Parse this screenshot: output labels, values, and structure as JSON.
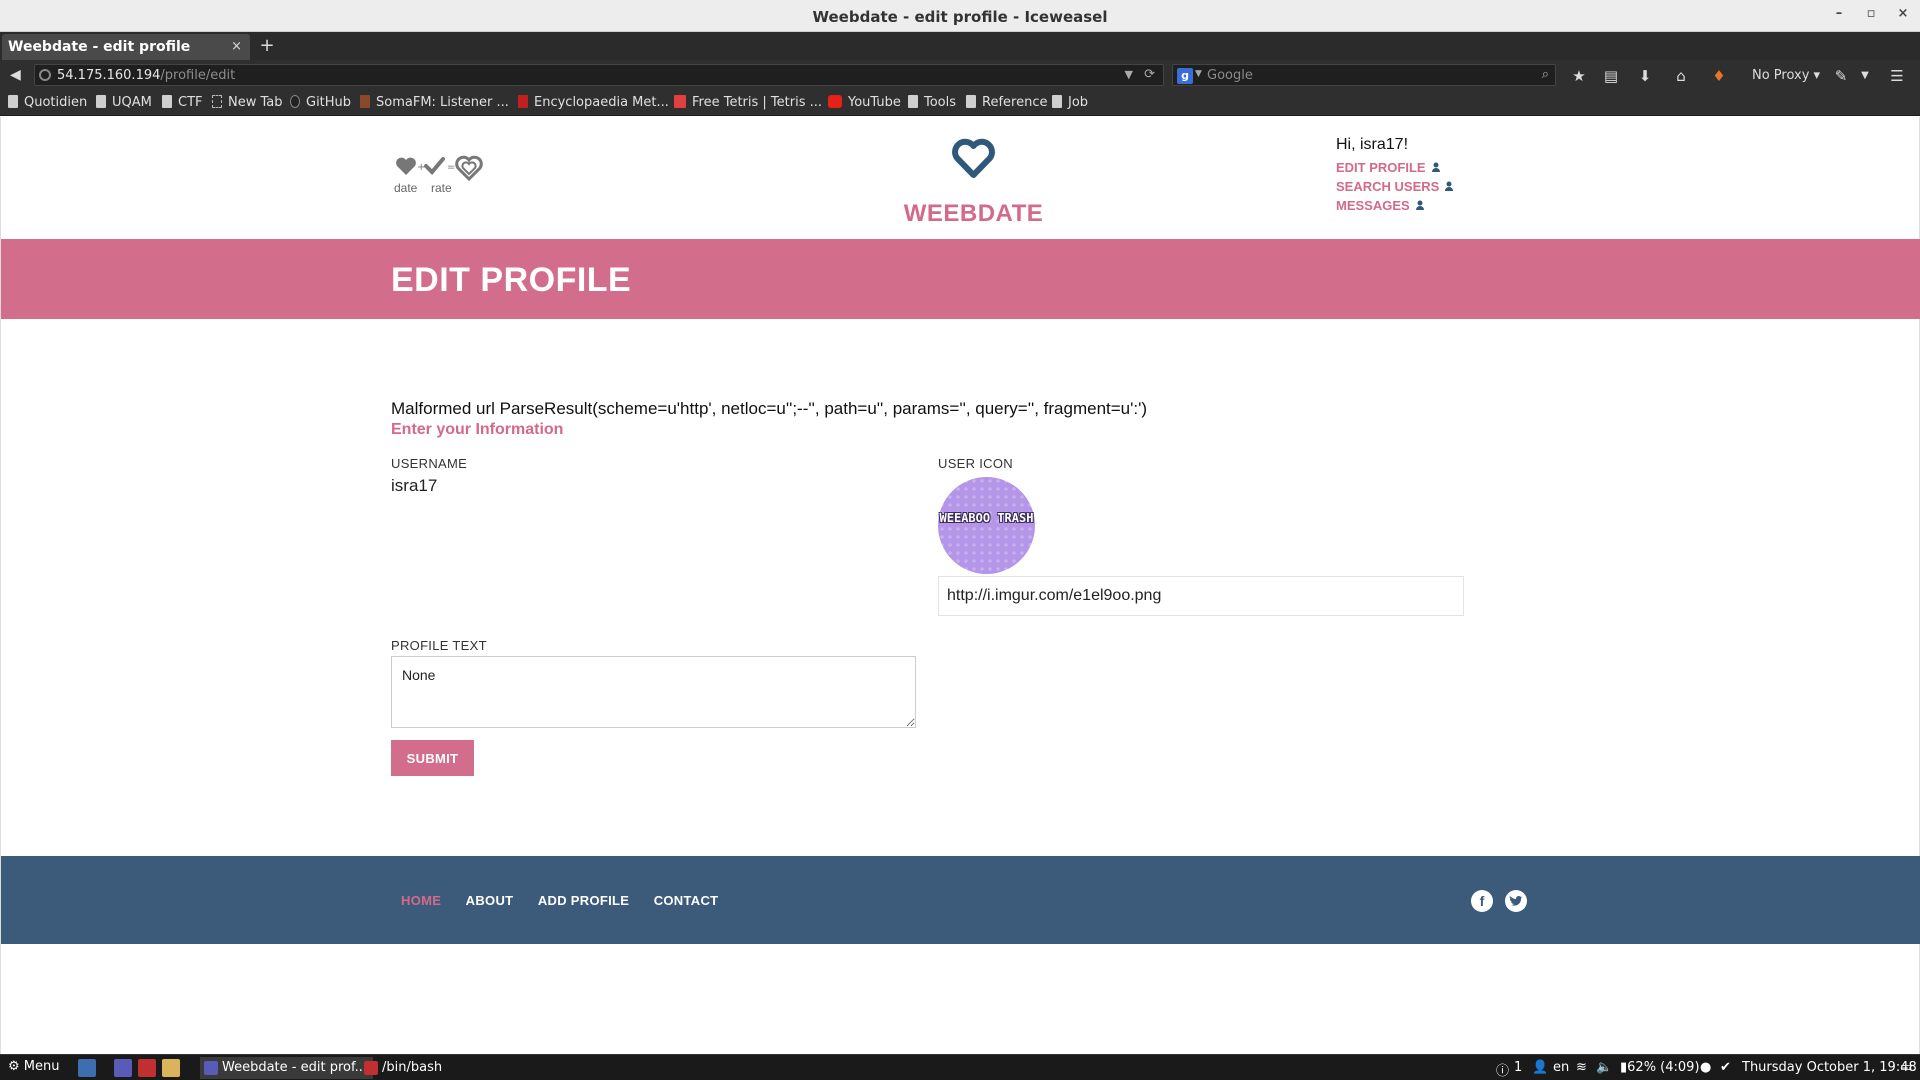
{
  "window": {
    "title": "Weebdate - edit profile - Iceweasel",
    "minimize": "–",
    "maximize": "▫",
    "close": "×"
  },
  "tabs": [
    {
      "label": "Weebdate - edit profile",
      "close": "×"
    }
  ],
  "new_tab": "+",
  "navbar": {
    "url_host": "54.175.160.194",
    "url_path": "/profile/edit",
    "search_placeholder": "Google",
    "proxy": "No Proxy ▾"
  },
  "bookmarks": [
    "Quotidien",
    "UQAM",
    "CTF",
    "New Tab",
    "GitHub",
    "SomaFM: Listener ...",
    "Encyclopaedia Met...",
    "Free Tetris | Tetris ...",
    "YouTube",
    "Tools",
    "Reference",
    "Job"
  ],
  "site": {
    "logo_small": {
      "date": "date",
      "rate": "rate"
    },
    "brand": "WEEBDATE",
    "greeting": "Hi, isra17!",
    "user_links": [
      "EDIT PROFILE",
      "SEARCH USERS",
      "MESSAGES"
    ],
    "banner_title": "EDIT PROFILE",
    "error_message": "Malformed url ParseResult(scheme=u'http', netloc=u'';--'', path=u'', params='', query='', fragment=u':')",
    "subheading": "Enter your Information",
    "fields": {
      "username_label": "USERNAME",
      "username_value": "isra17",
      "user_icon_label": "USER ICON",
      "avatar_text": "WEEABOO TRASH",
      "icon_url": "http://i.imgur.com/e1el9oo.png",
      "profile_text_label": "PROFILE TEXT",
      "profile_text": "None"
    },
    "submit": "SUBMIT",
    "footer_nav": [
      "HOME",
      "ABOUT",
      "ADD PROFILE",
      "CONTACT"
    ],
    "footer_social": [
      "facebook-icon",
      "twitter-icon"
    ],
    "colors": {
      "accent": "#d36d8c",
      "footer": "#3c5b7b",
      "logo": "#2f587a"
    }
  },
  "taskbar": {
    "menu": "Menu",
    "tasks": [
      "Weebdate - edit prof...",
      "/bin/bash"
    ],
    "tray_count": "1",
    "lang": "en",
    "battery": "62% (4:09)",
    "clock": "Thursday October 1, 19:48"
  }
}
